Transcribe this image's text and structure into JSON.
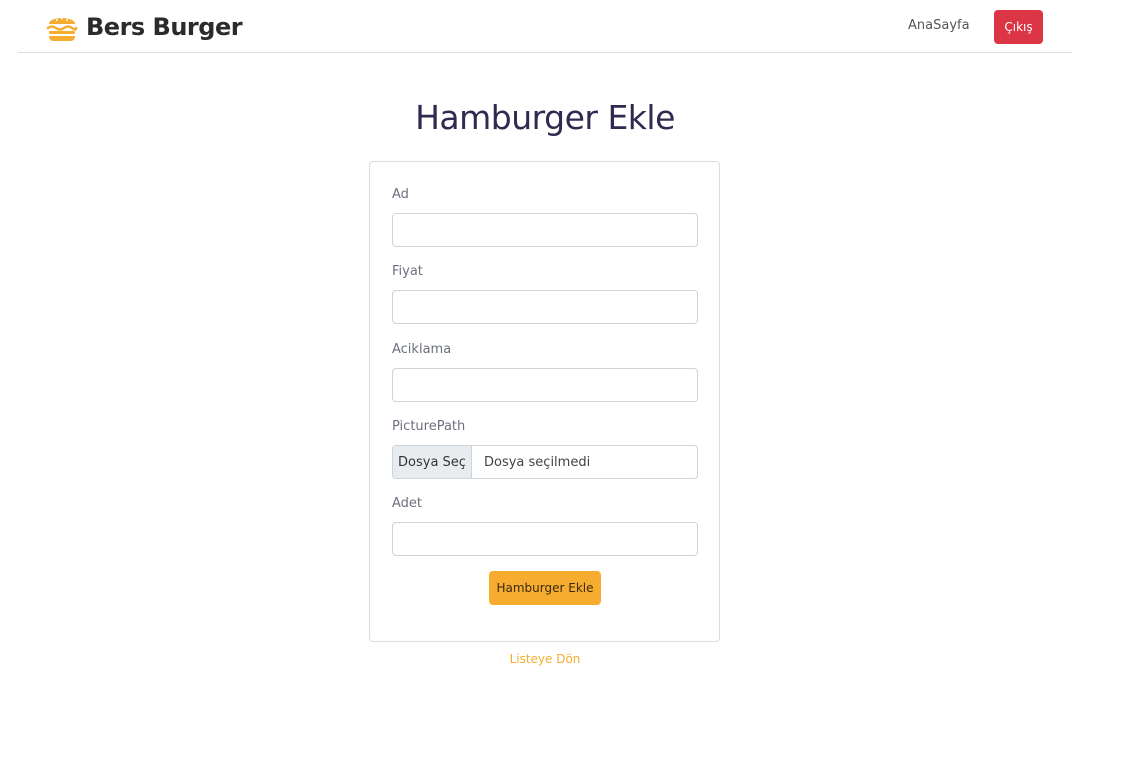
{
  "navbar": {
    "brand": "Bers Burger",
    "brand_icon": "burger-icon",
    "home_link": "AnaSayfa",
    "logout_label": "Çıkış",
    "colors": {
      "logout": "#dc3545",
      "brand_icon": "#f6ad2f"
    }
  },
  "page": {
    "title": "Hamburger Ekle"
  },
  "form": {
    "name_label": "Ad",
    "price_label": "Fiyat",
    "description_label": "Aciklama",
    "picture_label": "PicturePath",
    "file_button": "Dosya Seç",
    "file_status": "Dosya seçilmedi",
    "quantity_label": "Adet",
    "submit_label": "Hamburger Ekle",
    "colors": {
      "submit": "#f6ad2f"
    }
  },
  "footer": {
    "back_link": "Listeye Dön"
  }
}
